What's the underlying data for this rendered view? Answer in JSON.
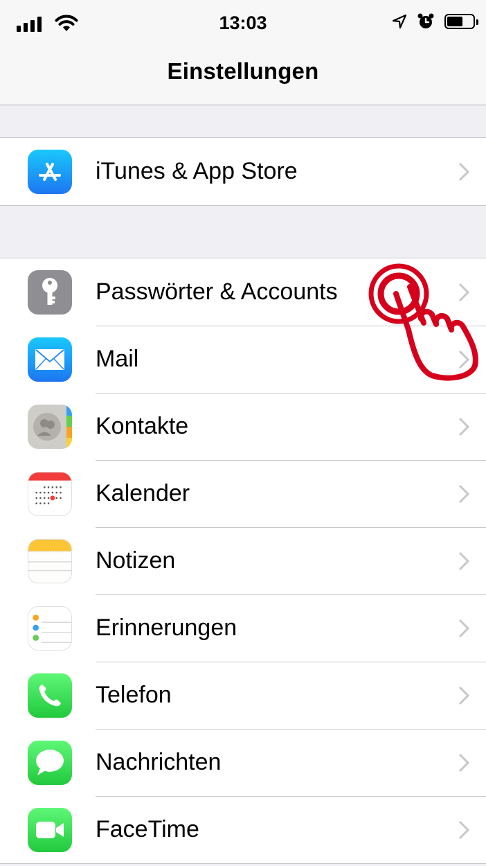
{
  "status_bar": {
    "time": "13:03",
    "icons": [
      "signal-icon",
      "wifi-icon",
      "location-icon",
      "alarm-icon",
      "battery-icon"
    ]
  },
  "nav": {
    "title": "Einstellungen"
  },
  "groups": [
    {
      "items": [
        {
          "label": "iTunes & App Store",
          "icon": "app-store-icon"
        }
      ]
    },
    {
      "items": [
        {
          "label": "Passwörter & Accounts",
          "icon": "key-icon"
        },
        {
          "label": "Mail",
          "icon": "mail-icon"
        },
        {
          "label": "Kontakte",
          "icon": "contacts-icon"
        },
        {
          "label": "Kalender",
          "icon": "calendar-icon"
        },
        {
          "label": "Notizen",
          "icon": "notes-icon"
        },
        {
          "label": "Erinnerungen",
          "icon": "reminders-icon"
        },
        {
          "label": "Telefon",
          "icon": "phone-icon"
        },
        {
          "label": "Nachrichten",
          "icon": "messages-icon"
        },
        {
          "label": "FaceTime",
          "icon": "facetime-icon"
        }
      ]
    }
  ],
  "overlay": {
    "icon": "tap-hand-icon",
    "color": "#d6001c"
  }
}
